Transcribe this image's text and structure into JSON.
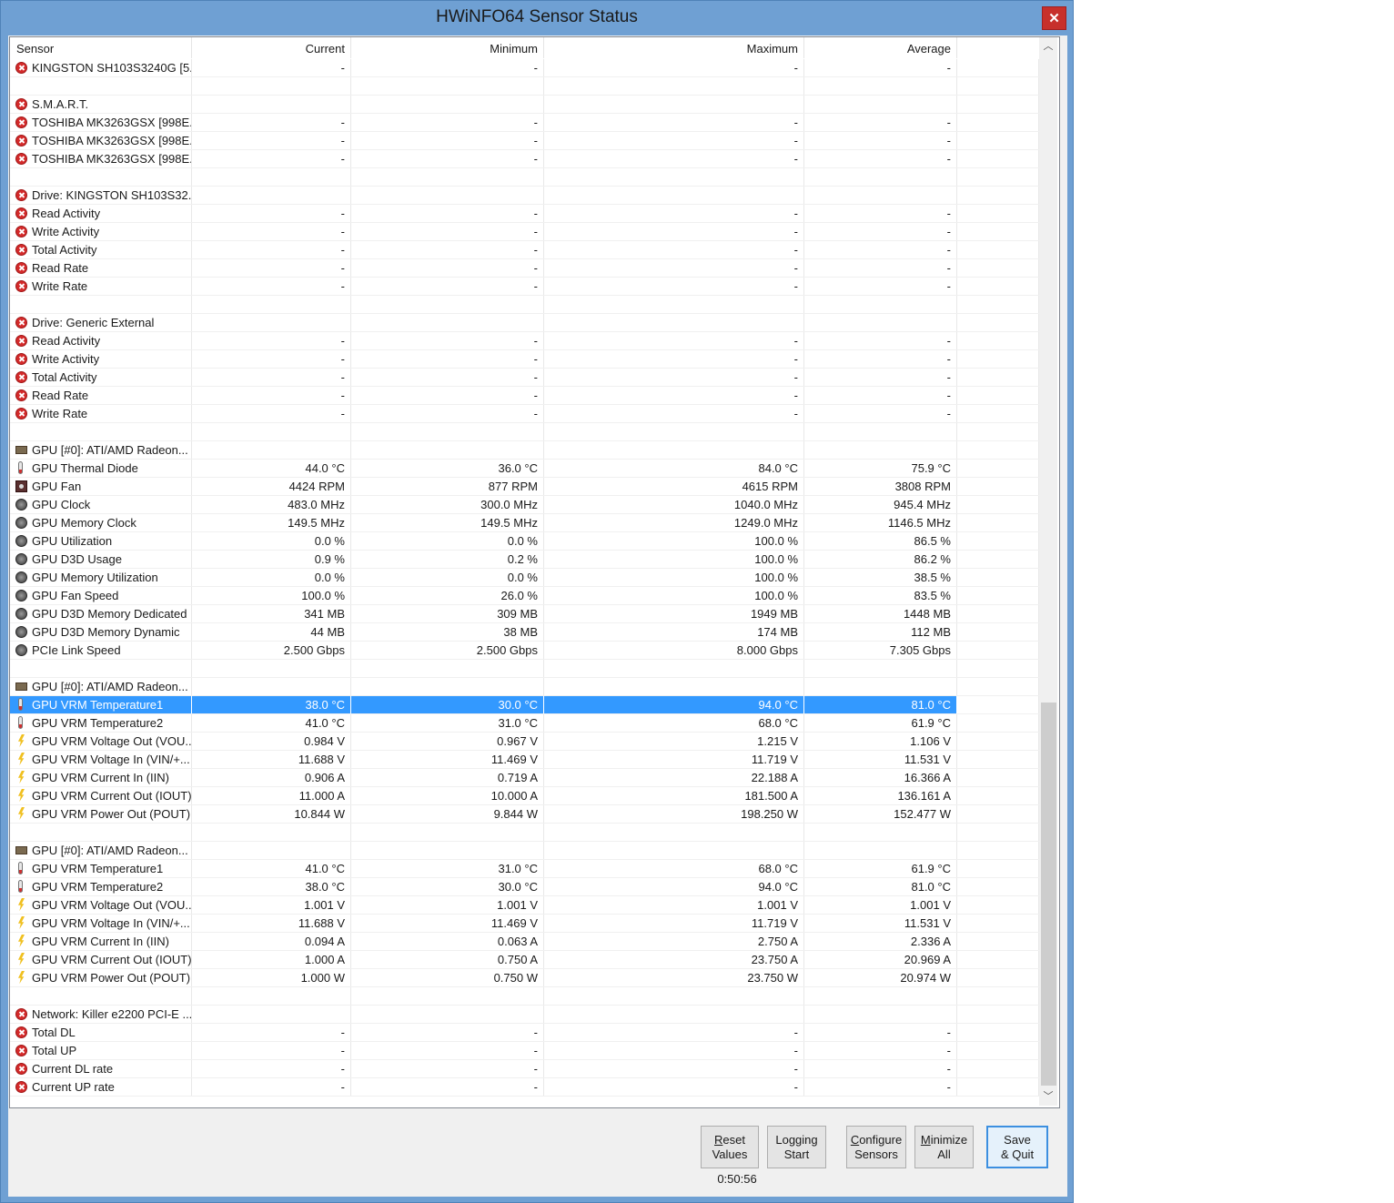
{
  "window": {
    "title": "HWiNFO64 Sensor Status",
    "close_glyph": "✕"
  },
  "columns": [
    "Sensor",
    "Current",
    "Minimum",
    "Maximum",
    "Average"
  ],
  "rows": [
    {
      "icon": "error",
      "name": "KINGSTON SH103S3240G [5...",
      "cur": "-",
      "min": "-",
      "max": "-",
      "avg": "-"
    },
    {
      "icon": "",
      "name": "",
      "cur": "",
      "min": "",
      "max": "",
      "avg": ""
    },
    {
      "icon": "error",
      "name": "S.M.A.R.T.",
      "cur": "",
      "min": "",
      "max": "",
      "avg": ""
    },
    {
      "icon": "error",
      "name": "TOSHIBA MK3263GSX [998E...",
      "cur": "-",
      "min": "-",
      "max": "-",
      "avg": "-"
    },
    {
      "icon": "error",
      "name": "TOSHIBA MK3263GSX [998E...",
      "cur": "-",
      "min": "-",
      "max": "-",
      "avg": "-"
    },
    {
      "icon": "error",
      "name": "TOSHIBA MK3263GSX [998E...",
      "cur": "-",
      "min": "-",
      "max": "-",
      "avg": "-"
    },
    {
      "icon": "",
      "name": "",
      "cur": "",
      "min": "",
      "max": "",
      "avg": ""
    },
    {
      "icon": "error",
      "name": "Drive: KINGSTON SH103S32...",
      "cur": "",
      "min": "",
      "max": "",
      "avg": ""
    },
    {
      "icon": "error",
      "name": "Read Activity",
      "cur": "-",
      "min": "-",
      "max": "-",
      "avg": "-"
    },
    {
      "icon": "error",
      "name": "Write Activity",
      "cur": "-",
      "min": "-",
      "max": "-",
      "avg": "-"
    },
    {
      "icon": "error",
      "name": "Total Activity",
      "cur": "-",
      "min": "-",
      "max": "-",
      "avg": "-"
    },
    {
      "icon": "error",
      "name": "Read Rate",
      "cur": "-",
      "min": "-",
      "max": "-",
      "avg": "-"
    },
    {
      "icon": "error",
      "name": "Write Rate",
      "cur": "-",
      "min": "-",
      "max": "-",
      "avg": "-"
    },
    {
      "icon": "",
      "name": "",
      "cur": "",
      "min": "",
      "max": "",
      "avg": ""
    },
    {
      "icon": "error",
      "name": "Drive: Generic External",
      "cur": "",
      "min": "",
      "max": "",
      "avg": ""
    },
    {
      "icon": "error",
      "name": "Read Activity",
      "cur": "-",
      "min": "-",
      "max": "-",
      "avg": "-"
    },
    {
      "icon": "error",
      "name": "Write Activity",
      "cur": "-",
      "min": "-",
      "max": "-",
      "avg": "-"
    },
    {
      "icon": "error",
      "name": "Total Activity",
      "cur": "-",
      "min": "-",
      "max": "-",
      "avg": "-"
    },
    {
      "icon": "error",
      "name": "Read Rate",
      "cur": "-",
      "min": "-",
      "max": "-",
      "avg": "-"
    },
    {
      "icon": "error",
      "name": "Write Rate",
      "cur": "-",
      "min": "-",
      "max": "-",
      "avg": "-"
    },
    {
      "icon": "",
      "name": "",
      "cur": "",
      "min": "",
      "max": "",
      "avg": ""
    },
    {
      "icon": "chip",
      "name": "GPU [#0]: ATI/AMD Radeon...",
      "cur": "",
      "min": "",
      "max": "",
      "avg": ""
    },
    {
      "icon": "thermometer",
      "name": "GPU Thermal Diode",
      "cur": "44.0 °C",
      "min": "36.0 °C",
      "max": "84.0 °C",
      "avg": "75.9 °C"
    },
    {
      "icon": "fan",
      "name": "GPU Fan",
      "cur": "4424 RPM",
      "min": "877 RPM",
      "max": "4615 RPM",
      "avg": "3808 RPM"
    },
    {
      "icon": "gauge",
      "name": "GPU Clock",
      "cur": "483.0 MHz",
      "min": "300.0 MHz",
      "max": "1040.0 MHz",
      "avg": "945.4 MHz"
    },
    {
      "icon": "gauge",
      "name": "GPU Memory Clock",
      "cur": "149.5 MHz",
      "min": "149.5 MHz",
      "max": "1249.0 MHz",
      "avg": "1146.5 MHz"
    },
    {
      "icon": "gauge",
      "name": "GPU Utilization",
      "cur": "0.0 %",
      "min": "0.0 %",
      "max": "100.0 %",
      "avg": "86.5 %"
    },
    {
      "icon": "gauge",
      "name": "GPU D3D Usage",
      "cur": "0.9 %",
      "min": "0.2 %",
      "max": "100.0 %",
      "avg": "86.2 %"
    },
    {
      "icon": "gauge",
      "name": "GPU Memory Utilization",
      "cur": "0.0 %",
      "min": "0.0 %",
      "max": "100.0 %",
      "avg": "38.5 %"
    },
    {
      "icon": "gauge",
      "name": "GPU Fan Speed",
      "cur": "100.0 %",
      "min": "26.0 %",
      "max": "100.0 %",
      "avg": "83.5 %"
    },
    {
      "icon": "gauge",
      "name": "GPU D3D Memory Dedicated",
      "cur": "341 MB",
      "min": "309 MB",
      "max": "1949 MB",
      "avg": "1448 MB"
    },
    {
      "icon": "gauge",
      "name": "GPU D3D Memory Dynamic",
      "cur": "44 MB",
      "min": "38 MB",
      "max": "174 MB",
      "avg": "112 MB"
    },
    {
      "icon": "gauge",
      "name": "PCIe Link Speed",
      "cur": "2.500 Gbps",
      "min": "2.500 Gbps",
      "max": "8.000 Gbps",
      "avg": "7.305 Gbps"
    },
    {
      "icon": "",
      "name": "",
      "cur": "",
      "min": "",
      "max": "",
      "avg": ""
    },
    {
      "icon": "chip",
      "name": "GPU [#0]: ATI/AMD Radeon...",
      "cur": "",
      "min": "",
      "max": "",
      "avg": ""
    },
    {
      "icon": "thermometer",
      "name": "GPU VRM Temperature1",
      "cur": "38.0 °C",
      "min": "30.0 °C",
      "max": "94.0 °C",
      "avg": "81.0 °C",
      "selected": true
    },
    {
      "icon": "thermometer",
      "name": "GPU VRM Temperature2",
      "cur": "41.0 °C",
      "min": "31.0 °C",
      "max": "68.0 °C",
      "avg": "61.9 °C"
    },
    {
      "icon": "voltage",
      "name": "GPU VRM Voltage Out (VOU...",
      "cur": "0.984 V",
      "min": "0.967 V",
      "max": "1.215 V",
      "avg": "1.106 V"
    },
    {
      "icon": "voltage",
      "name": "GPU VRM Voltage In (VIN/+...",
      "cur": "11.688 V",
      "min": "11.469 V",
      "max": "11.719 V",
      "avg": "11.531 V"
    },
    {
      "icon": "voltage",
      "name": "GPU VRM Current In (IIN)",
      "cur": "0.906 A",
      "min": "0.719 A",
      "max": "22.188 A",
      "avg": "16.366 A"
    },
    {
      "icon": "voltage",
      "name": "GPU VRM Current Out (IOUT)",
      "cur": "11.000 A",
      "min": "10.000 A",
      "max": "181.500 A",
      "avg": "136.161 A"
    },
    {
      "icon": "voltage",
      "name": "GPU VRM Power Out (POUT)",
      "cur": "10.844 W",
      "min": "9.844 W",
      "max": "198.250 W",
      "avg": "152.477 W"
    },
    {
      "icon": "",
      "name": "",
      "cur": "",
      "min": "",
      "max": "",
      "avg": ""
    },
    {
      "icon": "chip",
      "name": "GPU [#0]: ATI/AMD Radeon...",
      "cur": "",
      "min": "",
      "max": "",
      "avg": ""
    },
    {
      "icon": "thermometer",
      "name": "GPU VRM Temperature1",
      "cur": "41.0 °C",
      "min": "31.0 °C",
      "max": "68.0 °C",
      "avg": "61.9 °C"
    },
    {
      "icon": "thermometer",
      "name": "GPU VRM Temperature2",
      "cur": "38.0 °C",
      "min": "30.0 °C",
      "max": "94.0 °C",
      "avg": "81.0 °C"
    },
    {
      "icon": "voltage",
      "name": "GPU VRM Voltage Out (VOU...",
      "cur": "1.001 V",
      "min": "1.001 V",
      "max": "1.001 V",
      "avg": "1.001 V"
    },
    {
      "icon": "voltage",
      "name": "GPU VRM Voltage In (VIN/+...",
      "cur": "11.688 V",
      "min": "11.469 V",
      "max": "11.719 V",
      "avg": "11.531 V"
    },
    {
      "icon": "voltage",
      "name": "GPU VRM Current In (IIN)",
      "cur": "0.094 A",
      "min": "0.063 A",
      "max": "2.750 A",
      "avg": "2.336 A"
    },
    {
      "icon": "voltage",
      "name": "GPU VRM Current Out (IOUT)",
      "cur": "1.000 A",
      "min": "0.750 A",
      "max": "23.750 A",
      "avg": "20.969 A"
    },
    {
      "icon": "voltage",
      "name": "GPU VRM Power Out (POUT)",
      "cur": "1.000 W",
      "min": "0.750 W",
      "max": "23.750 W",
      "avg": "20.974 W"
    },
    {
      "icon": "",
      "name": "",
      "cur": "",
      "min": "",
      "max": "",
      "avg": ""
    },
    {
      "icon": "error",
      "name": "Network: Killer e2200 PCI-E ...",
      "cur": "",
      "min": "",
      "max": "",
      "avg": ""
    },
    {
      "icon": "error",
      "name": "Total DL",
      "cur": "-",
      "min": "-",
      "max": "-",
      "avg": "-"
    },
    {
      "icon": "error",
      "name": "Total UP",
      "cur": "-",
      "min": "-",
      "max": "-",
      "avg": "-"
    },
    {
      "icon": "error",
      "name": "Current DL rate",
      "cur": "-",
      "min": "-",
      "max": "-",
      "avg": "-"
    },
    {
      "icon": "error",
      "name": "Current UP rate",
      "cur": "-",
      "min": "-",
      "max": "-",
      "avg": "-"
    }
  ],
  "scrollbar": {
    "up_glyph": "︿",
    "down_glyph": "﹀"
  },
  "buttons": {
    "reset": {
      "line1_accel": "R",
      "line1_rest": "eset",
      "line2": "Values"
    },
    "logging": {
      "line1": "Logging",
      "line2": "Start"
    },
    "configure": {
      "line1_accel": "C",
      "line1_rest": "onfigure",
      "line2": "Sensors"
    },
    "minimize": {
      "line1_accel": "M",
      "line1_rest": "inimize",
      "line2": "All"
    },
    "save": {
      "line1": "Save",
      "line2": "& Quit"
    }
  },
  "timer": "0:50:56"
}
